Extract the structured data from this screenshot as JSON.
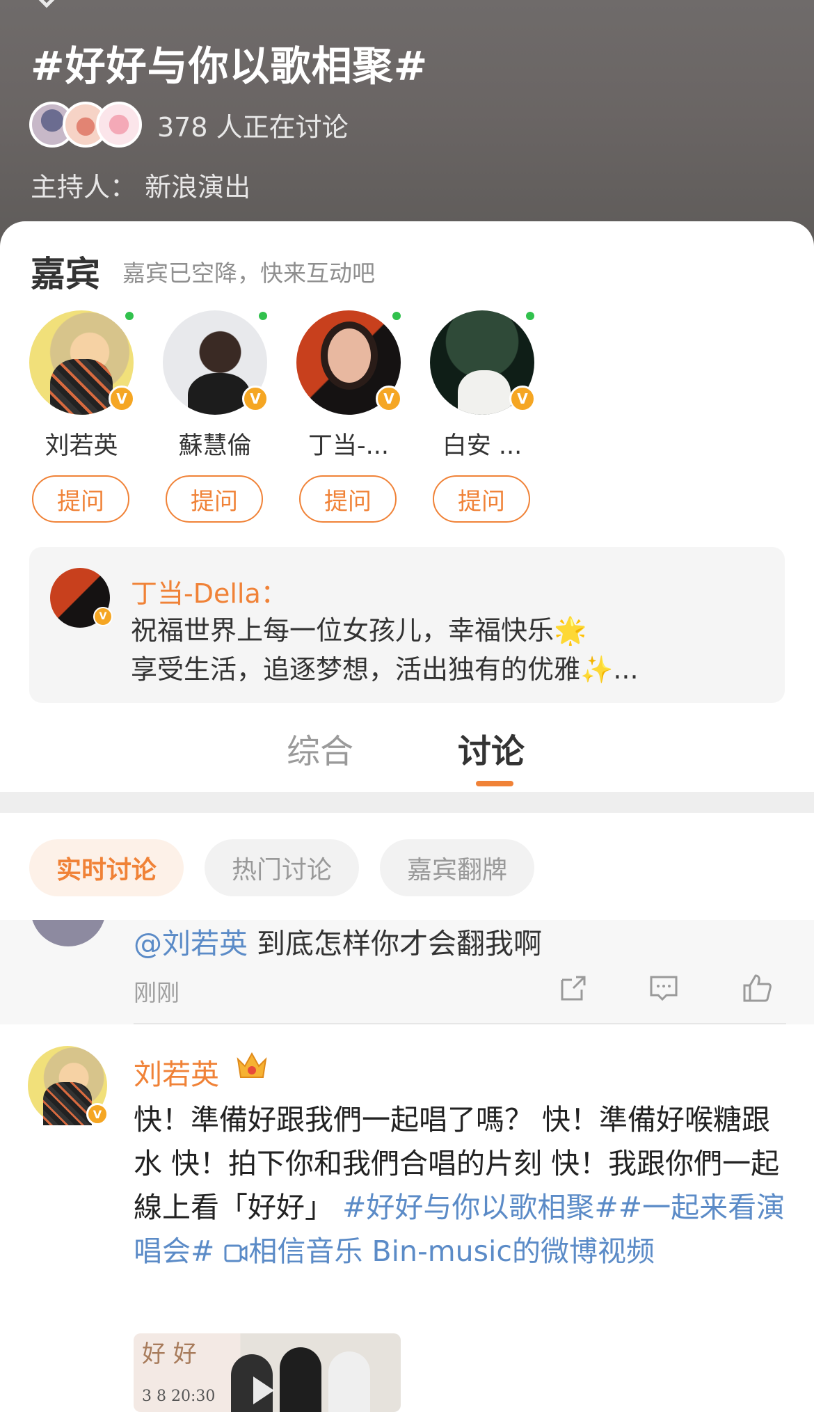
{
  "topic": {
    "title": "#好好与你以歌相聚#",
    "discuss_count": "378 人正在讨论",
    "host": "主持人：  新浪演出"
  },
  "guests": {
    "title": "嘉宾",
    "subtitle": "嘉宾已空降，快来互动吧",
    "items": [
      {
        "name": "刘若英",
        "ask": "提问",
        "online": true
      },
      {
        "name": "蘇慧倫",
        "ask": "提问",
        "online": true
      },
      {
        "name": "丁当-...",
        "ask": "提问",
        "online": true
      },
      {
        "name": "白安 ...",
        "ask": "提问",
        "online": true
      }
    ],
    "badge_letter": "V"
  },
  "quote": {
    "name": "丁当-Della：",
    "line1": "祝福世界上每一位女孩儿，幸福快乐🌟",
    "line2": "享受生活，追逐梦想，活出独有的优雅✨..."
  },
  "tabs": [
    {
      "label": "综合",
      "active": false
    },
    {
      "label": "讨论",
      "active": true
    }
  ],
  "filters": [
    {
      "label": "实时讨论",
      "active": true
    },
    {
      "label": "热门讨论",
      "active": false
    },
    {
      "label": "嘉宾翻牌",
      "active": false
    }
  ],
  "prev_post": {
    "mention": "@刘若英",
    "text": " 到底怎样你才会翻我啊",
    "time": "刚刚"
  },
  "post": {
    "author": "刘若英",
    "text_plain": "快！準備好跟我們一起唱了嗎？ 快！準備好喉糖跟水 快！拍下你和我們合唱的片刻 快！我跟你們一起線上看「好好」 ",
    "topics": "#好好与你以歌相聚##一起来看演唱会#",
    "video_link": "相信音乐 Bin-music的微博视频",
    "thumb_title": "好 好",
    "thumb_date": "3 8  20:30"
  },
  "colors": {
    "accent": "#f08237",
    "link": "#5b8bc7",
    "online": "#31c14d",
    "verified": "#f5a623"
  }
}
